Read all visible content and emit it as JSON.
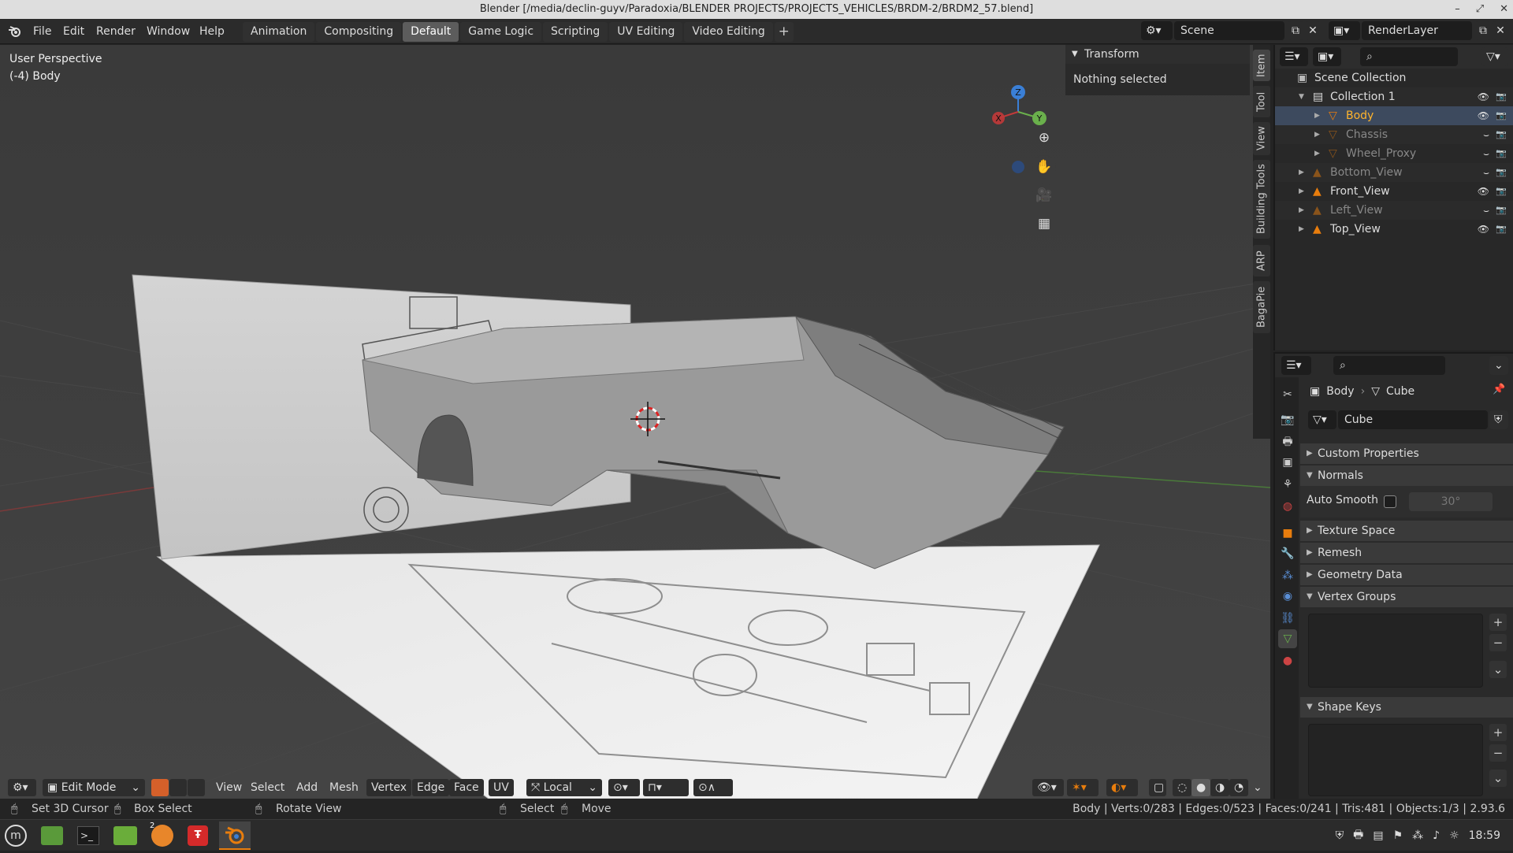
{
  "window": {
    "title": "Blender [/media/declin-guyv/Paradoxia/BLENDER PROJECTS/PROJECTS_VEHICLES/BRDM-2/BRDM2_57.blend]"
  },
  "menu": [
    "File",
    "Edit",
    "Render",
    "Window",
    "Help"
  ],
  "workspaces": {
    "tabs": [
      "Animation",
      "Compositing",
      "Default",
      "Game Logic",
      "Scripting",
      "UV Editing",
      "Video Editing"
    ],
    "active": "Default",
    "add": "+"
  },
  "scene": {
    "name": "Scene",
    "render_layer": "RenderLayer"
  },
  "viewport": {
    "perspective": "User Perspective",
    "object_info": "(-4) Body",
    "gizmo_axes": [
      "Z",
      "Y",
      "X"
    ]
  },
  "npanel": {
    "transform_title": "Transform",
    "nothing_selected": "Nothing selected",
    "tabs": [
      "Item",
      "Tool",
      "View",
      "Building Tools",
      "ARP",
      "BagaPie"
    ]
  },
  "outliner": {
    "rows": [
      {
        "label": "Scene Collection",
        "indent": 0,
        "kind": "scene",
        "dim": false,
        "selected": false
      },
      {
        "label": "Collection 1",
        "indent": 1,
        "kind": "collection",
        "dim": false,
        "selected": false
      },
      {
        "label": "Body",
        "indent": 2,
        "kind": "mesh",
        "dim": false,
        "selected": true
      },
      {
        "label": "Chassis",
        "indent": 2,
        "kind": "mesh",
        "dim": true,
        "selected": false
      },
      {
        "label": "Wheel_Proxy",
        "indent": 2,
        "kind": "mesh",
        "dim": true,
        "selected": false
      },
      {
        "label": "Bottom_View",
        "indent": 1,
        "kind": "image",
        "dim": true,
        "selected": false
      },
      {
        "label": "Front_View",
        "indent": 1,
        "kind": "image",
        "dim": false,
        "selected": false
      },
      {
        "label": "Left_View",
        "indent": 1,
        "kind": "image",
        "dim": true,
        "selected": false
      },
      {
        "label": "Top_View",
        "indent": 1,
        "kind": "image",
        "dim": false,
        "selected": false
      }
    ]
  },
  "properties": {
    "object": "Body",
    "mesh": "Cube",
    "datablock": "Cube",
    "sections": [
      "Custom Properties",
      "Normals",
      "Texture Space",
      "Remesh",
      "Geometry Data",
      "Vertex Groups",
      "Shape Keys"
    ],
    "auto_smooth_label": "Auto Smooth",
    "auto_smooth_angle": "30°"
  },
  "viewport_header": {
    "mode": "Edit Mode",
    "menus": [
      "View",
      "Select",
      "Add",
      "Mesh",
      "Vertex",
      "Edge",
      "Face",
      "UV"
    ],
    "transform_orientation": "Local"
  },
  "statusbar": {
    "items": [
      "Set 3D Cursor",
      "Box Select",
      "Rotate View",
      "Select",
      "Move"
    ],
    "stats": "Body | Verts:0/283 | Edges:0/523 | Faces:0/241 | Tris:481 | Objects:1/3 | 2.93.6"
  },
  "taskbar": {
    "time": "18:59",
    "badge": "2"
  },
  "colors": {
    "accent": "#e87d0d",
    "selected_text": "#ffb42c",
    "active_tab": "#5c5c5c"
  }
}
